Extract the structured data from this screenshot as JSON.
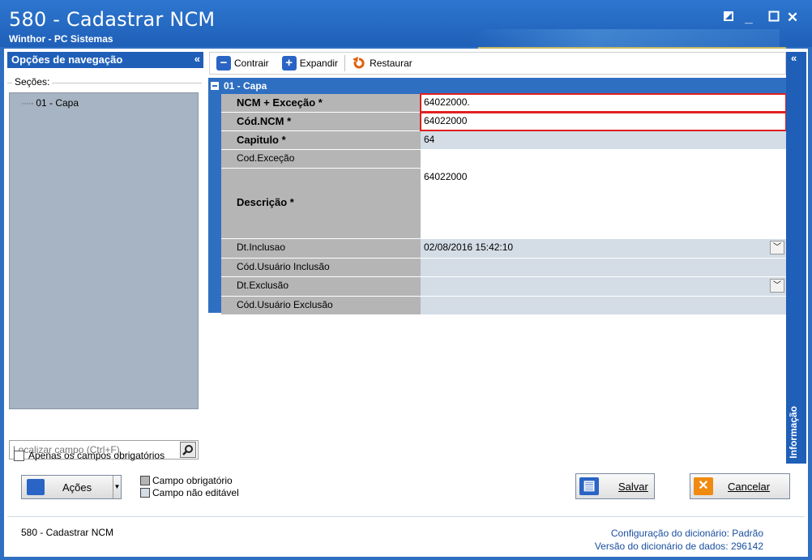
{
  "window": {
    "title": "580 - Cadastrar  NCM",
    "subtitle": "Winthor - PC Sistemas"
  },
  "nav": {
    "header": "Opções de navegação",
    "collapse": "«",
    "sections_label": "Seções:",
    "tree_items": [
      "01 - Capa"
    ],
    "search_placeholder": "Localizar campo (Ctrl+F)",
    "only_required_label": "Apenas os campos obrigatórios"
  },
  "toolbar": {
    "contrair": "Contrair",
    "expandir": "Expandir",
    "restaurar": "Restaurar"
  },
  "section": {
    "title": "01 - Capa"
  },
  "fields": [
    {
      "label": "NCM + Exceção *",
      "value": "64022000."
    },
    {
      "label": "Cód.NCM *",
      "value": "64022000"
    },
    {
      "label": "Capitulo *",
      "value": "64"
    },
    {
      "label": "Cod.Exceção",
      "value": ""
    },
    {
      "label": "Descrição *",
      "value": "64022000"
    },
    {
      "label": "Dt.Inclusao",
      "value": "02/08/2016 15:42:10"
    },
    {
      "label": "Cód.Usuário Inclusão",
      "value": ""
    },
    {
      "label": "Dt.Exclusão",
      "value": ""
    },
    {
      "label": "Cód.Usuário Exclusão",
      "value": ""
    }
  ],
  "info_panel": {
    "label": "Informação",
    "collapse": "«"
  },
  "actions": {
    "acoes": "Ações",
    "salvar": "Salvar",
    "cancelar": "Cancelar"
  },
  "legend": {
    "required": "Campo obrigatório",
    "not_editable": "Campo não editável"
  },
  "status": {
    "left": "580 - Cadastrar  NCM",
    "dict_config_label": "Configuração do dicionário:",
    "dict_config_value": "Padrão",
    "dict_version_label": "Versão do dicionário de dados:",
    "dict_version_value": "296142"
  },
  "colors": {
    "title_blue": "#1f5fb8",
    "tree_bg": "#a7b4c3",
    "label_cell": "#b5b5b5",
    "highlight": "#e02020"
  }
}
